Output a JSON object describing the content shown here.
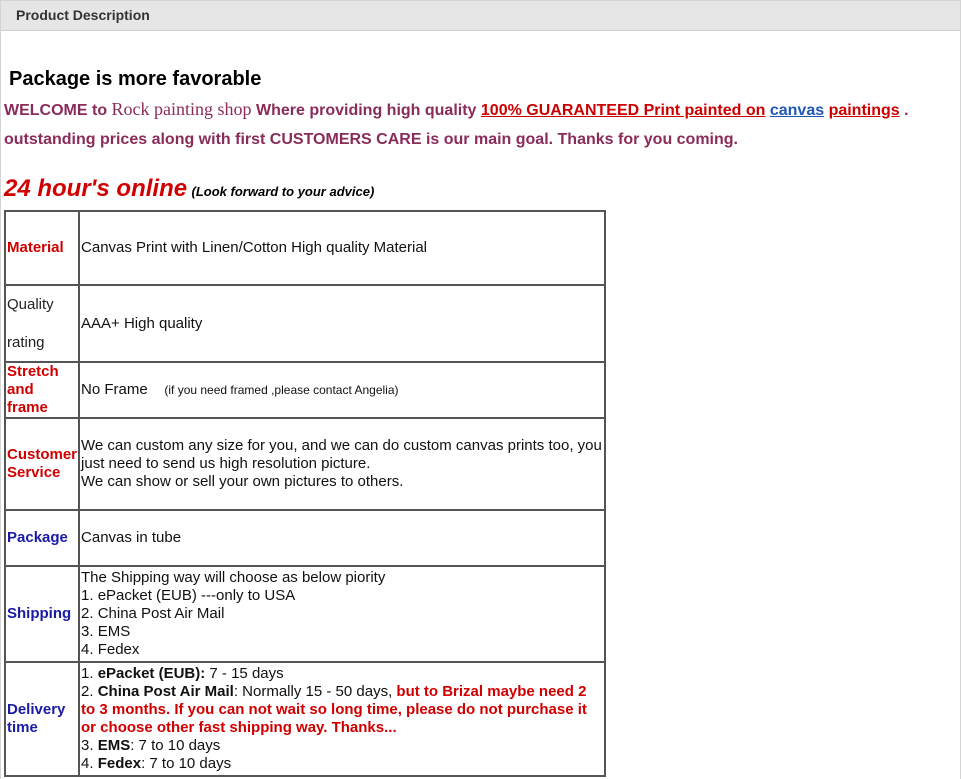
{
  "tab": {
    "title": "Product Description"
  },
  "headline": "Package is more favorable",
  "intro": {
    "welcome": "WELCOME to",
    "shop": "Rock painting shop",
    "where": "Where providing high quality",
    "guarantee": "100% GUARANTEED Print painted  on",
    "canvas": "canvas",
    "paintings": "paintings",
    "dot": ".",
    "line2": "outstanding   prices along with first  CUSTOMERS CARE is our main goal. Thanks for you coming."
  },
  "online": {
    "big": "24 hour's online",
    "small": "(Look forward to your advice)"
  },
  "rows": [
    {
      "label": "Material",
      "text": "Canvas Print with Linen/Cotton High quality Material"
    },
    {
      "label_top": "Quality",
      "label_bottom": "rating",
      "text": "AAA+  High quality"
    },
    {
      "label": "Stretch and frame",
      "text": "No Frame",
      "note": "(if you need framed ,please contact Angelia)"
    },
    {
      "label": "Customer Service",
      "line1": "We can custom any size for you, and we can do custom canvas prints too, you just need to send us high resolution picture.",
      "line2": "We can show or sell your own pictures to others."
    },
    {
      "label": "Package",
      "text": "Canvas in tube"
    },
    {
      "label": "Shipping",
      "lines": [
        "The Shipping way will choose as below piority",
        "1. ePacket (EUB) ---only to USA",
        "2. China Post Air Mail",
        "3. EMS",
        "4. Fedex"
      ]
    },
    {
      "label": "Delivery time",
      "d1_num": "1.  ",
      "d1_name": "ePacket (EUB):",
      "d1_val": " 7 - 15 days",
      "d2_num": "2.  ",
      "d2_name": "China Post Air Mail",
      "d2_val": ": Normally 15 - 50 days,  ",
      "d2_warn": "but to Brizal maybe need 2 to 3 months. If you can not wait so long time, please do not purchase it or choose other fast shipping way. Thanks...",
      "d3_num": "3.  ",
      "d3_name": "EMS",
      "d3_val": ": 7 to 10 days",
      "d4_num": "4.  ",
      "d4_name": "Fedex",
      "d4_val": ": 7 to 10 days"
    }
  ],
  "colors": {
    "red": "#d10000",
    "blue": "#1a1aa6",
    "plum": "#8a2c5a",
    "link_blue": "#1f57b8"
  }
}
